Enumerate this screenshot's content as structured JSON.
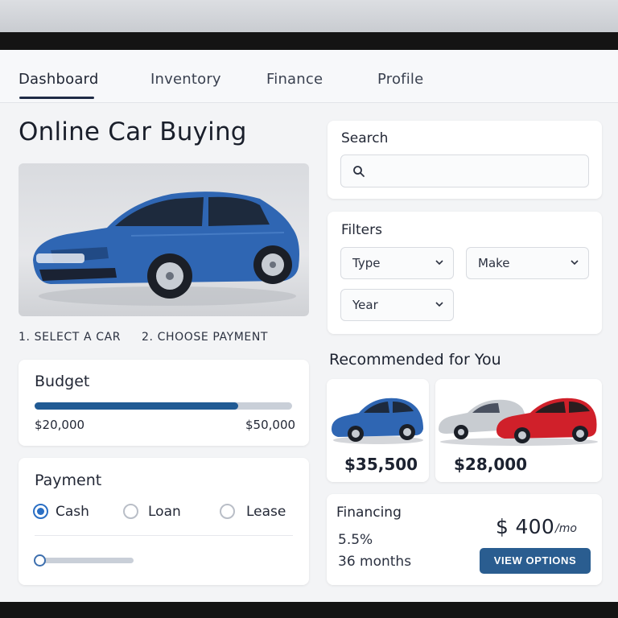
{
  "nav": {
    "tabs": [
      {
        "label": "Dashboard",
        "active": true
      },
      {
        "label": "Inventory",
        "active": false
      },
      {
        "label": "Finance",
        "active": false
      },
      {
        "label": "Profile",
        "active": false
      }
    ]
  },
  "page": {
    "title": "Online Car Buying"
  },
  "steps": [
    {
      "label": "1.  SELECT A CAR"
    },
    {
      "label": "2. CHOOSE PAYMENT"
    }
  ],
  "budget": {
    "label": "Budget",
    "min_label": "$20,000",
    "max_label": "$50,000",
    "fill_fraction": 0.79
  },
  "payment": {
    "label": "Payment",
    "options": [
      {
        "label": "Cash",
        "selected": true
      },
      {
        "label": "Loan",
        "selected": false
      },
      {
        "label": "Lease",
        "selected": false
      }
    ],
    "slider_fraction": 0.0
  },
  "search": {
    "label": "Search",
    "placeholder": ""
  },
  "filters": {
    "label": "Filters",
    "selects": [
      {
        "label": "Type"
      },
      {
        "label": "Make"
      },
      {
        "label": "Year"
      }
    ]
  },
  "recommended": {
    "title": "Recommended for You",
    "items": [
      {
        "price": "$35,500"
      },
      {
        "price": "$28,000"
      }
    ]
  },
  "financing": {
    "label": "Financing",
    "rate": "5.5%",
    "term": "36 months",
    "amount": "$ 400",
    "unit": "/mo",
    "button_label": "VIEW OPTIONS"
  },
  "colors": {
    "accent": "#2a5d90",
    "progress": "#215b94",
    "radio_on": "#2a6fc4",
    "car_blue": "#2f66b3",
    "car_red": "#d0202a",
    "car_silver": "#c8ccd1"
  },
  "icons": {
    "search": "search-icon",
    "chevron": "chevron-down-icon"
  }
}
